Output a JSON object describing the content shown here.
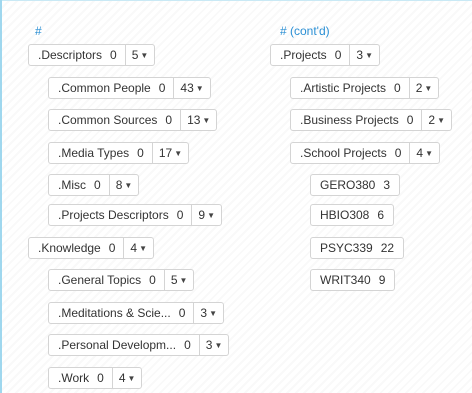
{
  "left": {
    "header": "#",
    "tags": [
      {
        "name": ".Descriptors",
        "count": "0",
        "children": "5"
      },
      {
        "name": ".Common People",
        "count": "0",
        "children": "43"
      },
      {
        "name": ".Common Sources",
        "count": "0",
        "children": "13"
      },
      {
        "name": ".Media Types",
        "count": "0",
        "children": "17"
      },
      {
        "name": ".Misc",
        "count": "0",
        "children": "8"
      },
      {
        "name": ".Projects Descriptors",
        "count": "0",
        "children": "9"
      },
      {
        "name": ".Knowledge",
        "count": "0",
        "children": "4"
      },
      {
        "name": ".General Topics",
        "count": "0",
        "children": "5"
      },
      {
        "name": ".Meditations & Scie...",
        "count": "0",
        "children": "3"
      },
      {
        "name": ".Personal Developm...",
        "count": "0",
        "children": "3"
      },
      {
        "name": ".Work",
        "count": "0",
        "children": "4"
      }
    ]
  },
  "right": {
    "header": "# (cont'd)",
    "tags": [
      {
        "name": ".Projects",
        "count": "0",
        "children": "3"
      },
      {
        "name": ".Artistic Projects",
        "count": "0",
        "children": "2"
      },
      {
        "name": ".Business Projects",
        "count": "0",
        "children": "2"
      },
      {
        "name": ".School Projects",
        "count": "0",
        "children": "4"
      },
      {
        "name": "GERO380",
        "count": "3"
      },
      {
        "name": "HBIO308",
        "count": "6"
      },
      {
        "name": "PSYC339",
        "count": "22"
      },
      {
        "name": "WRIT340",
        "count": "9"
      }
    ]
  },
  "icons": {
    "expand_caret": "caret-down-icon"
  },
  "colors": {
    "header_text": "#2a8fd4",
    "tag_border": "#d4d4d4",
    "frame_accent": "#9fd7ee"
  }
}
